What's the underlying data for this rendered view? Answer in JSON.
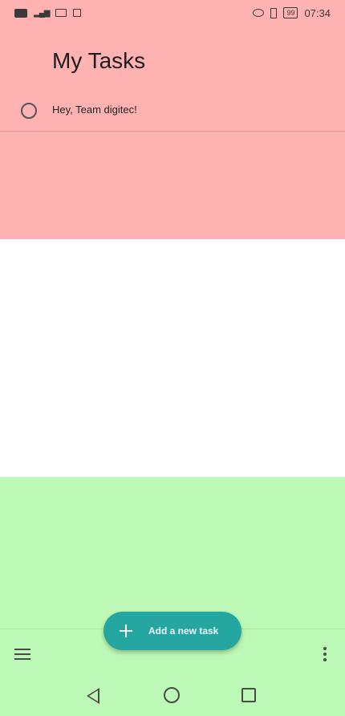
{
  "colors": {
    "top_region": "#ffb2b2",
    "bottom_region": "#bdf9b6",
    "fab": "#26a6a0"
  },
  "status_bar": {
    "battery": "99",
    "time": "07:34",
    "left_icons": [
      "nfc-icon",
      "signal-icon",
      "laptop-icon",
      "cast-icon"
    ],
    "right_icons": [
      "eye-icon",
      "vibrate-icon",
      "battery-icon"
    ]
  },
  "header": {
    "title": "My Tasks"
  },
  "tasks": [
    {
      "title": "Hey, Team digitec!",
      "completed": false
    }
  ],
  "fab": {
    "label": "Add a new task",
    "icon": "plus-icon"
  },
  "bottom_bar": {
    "left_icon": "menu-icon",
    "right_icon": "more-vert-icon"
  },
  "nav_bar": {
    "icons": [
      "back-icon",
      "home-icon",
      "recents-icon"
    ]
  }
}
